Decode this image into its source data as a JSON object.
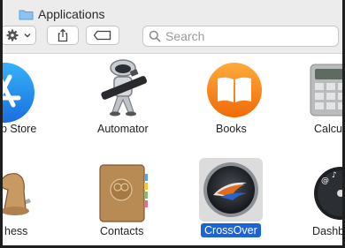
{
  "window": {
    "title": "Applications"
  },
  "toolbar": {
    "search_placeholder": "Search"
  },
  "apps": [
    {
      "label": "p Store"
    },
    {
      "label": "Automator"
    },
    {
      "label": "Books"
    },
    {
      "label": "Calcul"
    },
    {
      "label": "hess"
    },
    {
      "label": "Contacts"
    },
    {
      "label": "CrossOver",
      "selected": true
    },
    {
      "label": "Dashb"
    }
  ],
  "colors": {
    "selection": "#1b63d6",
    "toolbar_bg": "#ececec"
  }
}
